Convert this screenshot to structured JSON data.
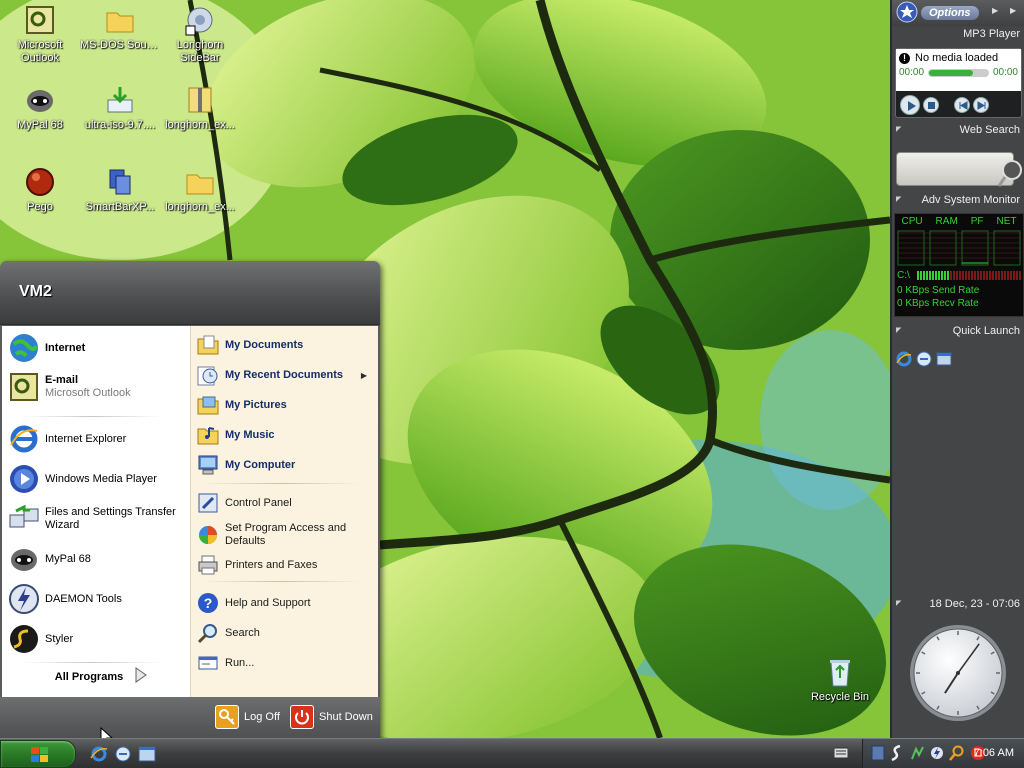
{
  "desktop": {
    "icons": [
      {
        "label": "Microsoft Outlook"
      },
      {
        "label": "MS-DOS Source"
      },
      {
        "label": "Longhorn SideBar"
      },
      {
        "label": "MyPal 68"
      },
      {
        "label": "ultra-iso-9.7...."
      },
      {
        "label": "longhorn_ex..."
      },
      {
        "label": "Pego"
      },
      {
        "label": "SmartBarXP..."
      },
      {
        "label": "longhorn_ex..."
      },
      {
        "label": "Recycle Bin"
      }
    ]
  },
  "start_menu": {
    "user": "VM2",
    "pinned": [
      {
        "label": "Internet"
      },
      {
        "label": "E-mail",
        "sub": "Microsoft Outlook"
      }
    ],
    "recent": [
      {
        "label": "Internet Explorer"
      },
      {
        "label": "Windows Media Player"
      },
      {
        "label": "Files and Settings Transfer Wizard"
      },
      {
        "label": "MyPal 68"
      },
      {
        "label": "DAEMON Tools"
      },
      {
        "label": "Styler"
      }
    ],
    "all_programs": "All Programs",
    "right_top": [
      {
        "label": "My Documents"
      },
      {
        "label": "My Recent Documents"
      },
      {
        "label": "My Pictures"
      },
      {
        "label": "My Music"
      },
      {
        "label": "My Computer"
      }
    ],
    "right_mid": [
      {
        "label": "Control Panel"
      },
      {
        "label": "Set Program Access and Defaults"
      },
      {
        "label": "Printers and Faxes"
      }
    ],
    "right_bottom": [
      {
        "label": "Help and Support"
      },
      {
        "label": "Search"
      },
      {
        "label": "Run..."
      }
    ],
    "log_off": "Log Off",
    "shut_down": "Shut Down"
  },
  "sidebar": {
    "options": "Options",
    "mp3": {
      "title": "MP3 Player",
      "status": "No media loaded",
      "time_start": "00:00",
      "time_end": "00:00"
    },
    "web_search": {
      "title": "Web Search"
    },
    "monitor": {
      "title": "Adv System Monitor",
      "cols": [
        "CPU",
        "RAM",
        "PF",
        "NET"
      ],
      "drive": "C:\\",
      "send": "0 KBps Send Rate",
      "recv": "0 KBps Recv Rate"
    },
    "quick_launch": {
      "title": "Quick Launch"
    },
    "clock": {
      "title": "18 Dec, 23 - 07:06",
      "hour": 7,
      "minute": 6
    }
  },
  "taskbar": {
    "time": "7:06 AM"
  },
  "colors": {
    "start_green": "#2a7a26",
    "sidebar_bg": "#444546",
    "monitor_green": "#35d235",
    "right_pane": "#fbf3df"
  }
}
